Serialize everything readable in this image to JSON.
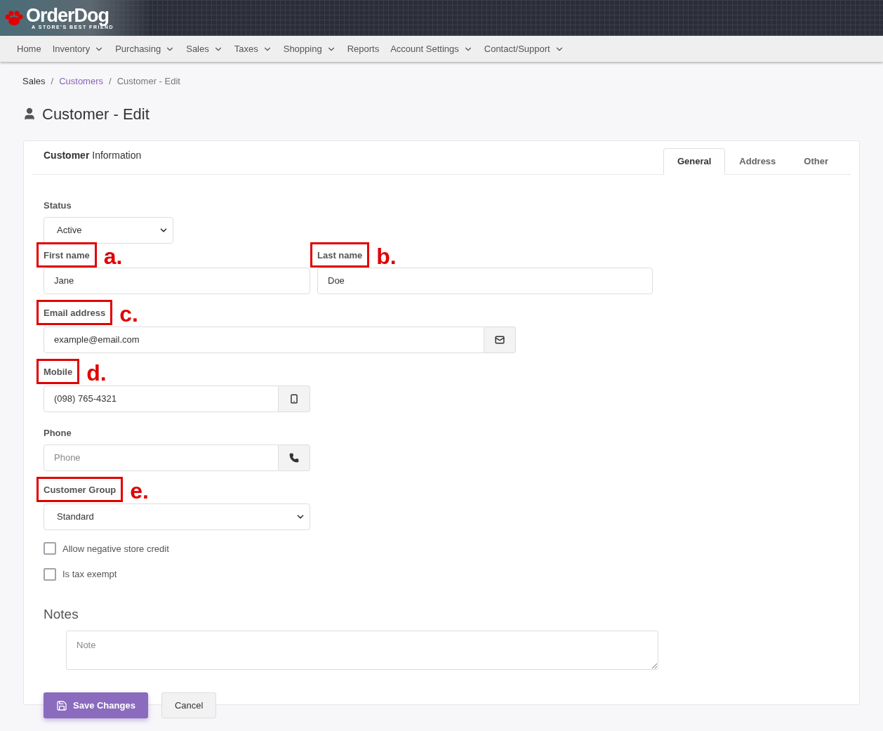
{
  "logo": {
    "name": "OrderDog",
    "tagline": "A STORE'S BEST FRIEND"
  },
  "nav": [
    {
      "label": "Home",
      "dropdown": false
    },
    {
      "label": "Inventory",
      "dropdown": true
    },
    {
      "label": "Purchasing",
      "dropdown": true
    },
    {
      "label": "Sales",
      "dropdown": true
    },
    {
      "label": "Taxes",
      "dropdown": true
    },
    {
      "label": "Shopping",
      "dropdown": true
    },
    {
      "label": "Reports",
      "dropdown": false
    },
    {
      "label": "Account Settings",
      "dropdown": true
    },
    {
      "label": "Contact/Support",
      "dropdown": true
    }
  ],
  "breadcrumb": [
    {
      "label": "Sales",
      "link": false
    },
    {
      "separator": "/",
      "label": "Customers",
      "link": true
    },
    {
      "separator": "/",
      "label": "Customer - Edit",
      "link": false
    }
  ],
  "page_title": "Customer - Edit",
  "card": {
    "title": "**Customer** Information",
    "tabs": [
      {
        "label": "General",
        "selected": true
      },
      {
        "label": "Address",
        "selected": false
      },
      {
        "label": "Other",
        "selected": false
      }
    ]
  },
  "status": {
    "label": "Status",
    "value": "Active"
  },
  "first_name": {
    "label": "First name",
    "marker": "a.",
    "value": "Jane"
  },
  "last_name": {
    "label": "Last name",
    "marker": "b.",
    "value": "Doe"
  },
  "email": {
    "label": "Email address",
    "marker": "c.",
    "value": "example@email.com"
  },
  "mobile": {
    "label": "Mobile",
    "marker": "d.",
    "value": "(098) 765-4321"
  },
  "phone": {
    "label": "Phone",
    "placeholder": "Phone"
  },
  "customer_group": {
    "label": "Customer Group",
    "marker": "e.",
    "value": "Standard"
  },
  "checkboxes": [
    {
      "label": "Allow negative store credit",
      "checked": false
    },
    {
      "label": "Is tax exempt",
      "checked": false
    }
  ],
  "notes": {
    "heading": "Notes",
    "placeholder": "Note"
  },
  "buttons": [
    {
      "kind": "primary",
      "label": "Save Changes"
    },
    {
      "kind": "secondary",
      "label": "Cancel"
    }
  ]
}
